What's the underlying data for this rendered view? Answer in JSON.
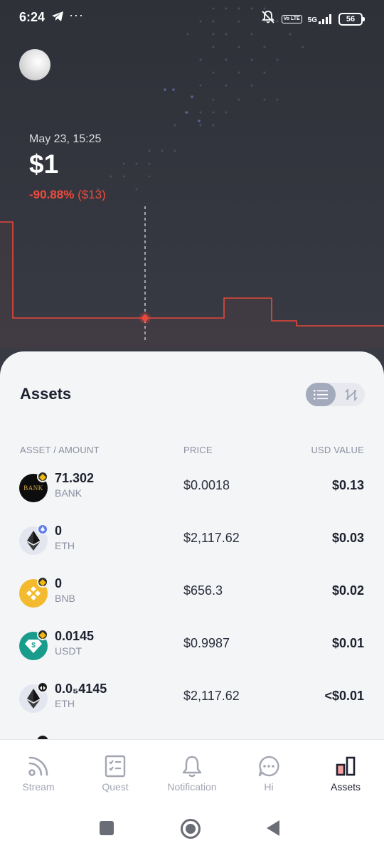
{
  "status_bar": {
    "time": "6:24",
    "more": "···",
    "volte": "Vo LTE",
    "network": "5G",
    "battery": "56"
  },
  "header": {
    "date_label": "May 23, 15:25",
    "balance": "$1",
    "change_percent": "-90.88%",
    "change_amount": "($13)"
  },
  "chart_data": {
    "type": "line",
    "x": [
      0,
      1,
      2,
      3,
      4,
      5,
      6,
      7,
      8,
      9,
      10,
      11
    ],
    "values": [
      13,
      1,
      1,
      1,
      1,
      1,
      1,
      1.9,
      1.9,
      0.9,
      0.6,
      0.6
    ],
    "title": "",
    "xlabel": "",
    "ylabel": "",
    "colors": {
      "line": "#e8473a",
      "marker": "#e8473a"
    }
  },
  "assets": {
    "title": "Assets",
    "columns": {
      "asset": "ASSET / AMOUNT",
      "price": "PRICE",
      "usd": "USD VALUE"
    },
    "rows": [
      {
        "amount": "71.302",
        "symbol": "BANK",
        "price": "$0.0018",
        "usd": "$0.13",
        "icon": "bank-coin-icon",
        "logo_text": "BANK"
      },
      {
        "amount": "0",
        "symbol": "ETH",
        "price": "$2,117.62",
        "usd": "$0.03",
        "icon": "ethereum-coin-icon"
      },
      {
        "amount": "0",
        "symbol": "BNB",
        "price": "$656.3",
        "usd": "$0.02",
        "icon": "bnb-coin-icon"
      },
      {
        "amount": "0.0145",
        "symbol": "USDT",
        "price": "$0.9987",
        "usd": "$0.01",
        "icon": "usdt-coin-icon"
      },
      {
        "amount": "0.0₅4145",
        "symbol": "ETH",
        "price": "$2,117.62",
        "usd": "<$0.01",
        "icon": "ethereum-coin-icon"
      }
    ]
  },
  "nav": {
    "items": [
      {
        "label": "Stream",
        "icon": "rss-icon"
      },
      {
        "label": "Quest",
        "icon": "checklist-icon"
      },
      {
        "label": "Notification",
        "icon": "bell-icon"
      },
      {
        "label": "Hi",
        "icon": "chat-bubble-icon"
      },
      {
        "label": "Assets",
        "icon": "bar-chart-icon",
        "active": true
      }
    ]
  },
  "colors": {
    "accent_negative": "#ee4b3e",
    "dark_bg": "#2e3038",
    "sheet_bg": "#f4f5f7"
  }
}
